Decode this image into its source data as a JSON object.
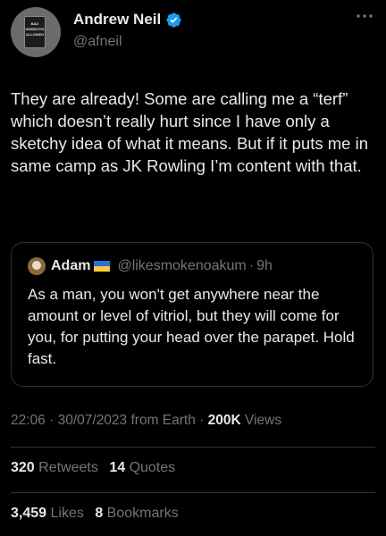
{
  "author": {
    "display_name": "Andrew Neil",
    "handle": "@afneil",
    "verified_color": "#1d9bf0",
    "avatar_sign_text": "BAD WEBSITES ALLOWED"
  },
  "tweet": {
    "text": "They are already! Some are calling me a “terf” which doesn’t really hurt since I have only a sketchy idea of what it means. But if it puts me in same camp as JK Rowling I’m content with that."
  },
  "quote": {
    "name": "Adam",
    "handle": "@likesmokenoakum",
    "separator": "·",
    "time": "9h",
    "text": "As a man, you won't get anywhere near the amount or level of vitriol, but they will come for you, for putting your head over the parapet. Hold fast."
  },
  "meta": {
    "time": "22:06",
    "sep": "·",
    "date": "30/07/2023",
    "source": "from Earth",
    "views_count": "200K",
    "views_label": "Views"
  },
  "stats": {
    "retweets_count": "320",
    "retweets_label": "Retweets",
    "quotes_count": "14",
    "quotes_label": "Quotes",
    "likes_count": "3,459",
    "likes_label": "Likes",
    "bookmarks_count": "8",
    "bookmarks_label": "Bookmarks"
  },
  "icons": {
    "verified": "verified-badge-icon",
    "more": "more-options-icon",
    "flag": "ukraine-flag-icon"
  }
}
